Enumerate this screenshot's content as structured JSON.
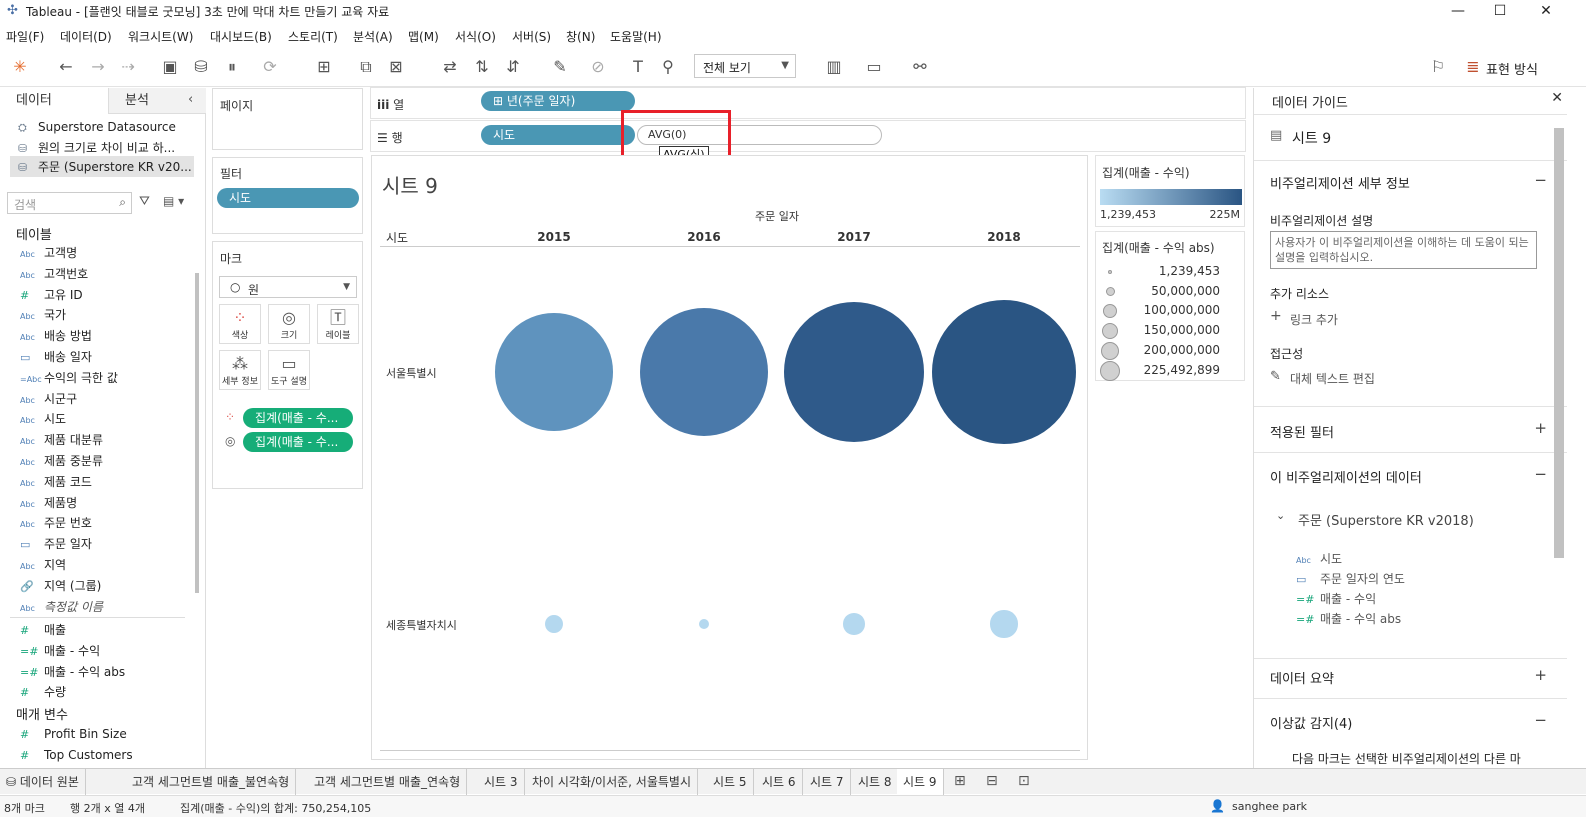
{
  "window": {
    "title": "Tableau - [플랜잇 태블로 굿모닝] 3초 만에 막대 차트 만들기 교육 자료",
    "minimize": "—",
    "maximize": "☐",
    "close": "✕"
  },
  "menu": [
    "파일(F)",
    "데이터(D)",
    "워크시트(W)",
    "대시보드(B)",
    "스토리(T)",
    "분석(A)",
    "맵(M)",
    "서식(O)",
    "서버(S)",
    "창(N)",
    "도움말(H)"
  ],
  "toolbar": {
    "view_select": "전체 보기",
    "show_me_label": "표현 방식"
  },
  "left_pane": {
    "tab_data": "데이터",
    "tab_analytics": "분석",
    "datasources": [
      "Superstore Datasource",
      "원의 크기로 차이 비교 하...",
      "주문 (Superstore KR v20..."
    ],
    "search_placeholder": "검색",
    "tables_header": "테이블",
    "dimensions": [
      {
        "type": "Abc",
        "name": "고객명"
      },
      {
        "type": "Abc",
        "name": "고객번호"
      },
      {
        "type": "#",
        "name": "고유 ID"
      },
      {
        "type": "Abc",
        "name": "국가"
      },
      {
        "type": "Abc",
        "name": "배송 방법"
      },
      {
        "type": "date",
        "name": "배송 일자"
      },
      {
        "type": "=Abc",
        "name": "수익의 극한 값"
      },
      {
        "type": "Abc",
        "name": "시군구"
      },
      {
        "type": "Abc",
        "name": "시도"
      },
      {
        "type": "Abc",
        "name": "제품 대분류"
      },
      {
        "type": "Abc",
        "name": "제품 중분류"
      },
      {
        "type": "Abc",
        "name": "제품 코드"
      },
      {
        "type": "Abc",
        "name": "제품명"
      },
      {
        "type": "Abc",
        "name": "주문 번호"
      },
      {
        "type": "date",
        "name": "주문 일자"
      },
      {
        "type": "Abc",
        "name": "지역"
      },
      {
        "type": "clip",
        "name": "지역 (그룹)"
      },
      {
        "type": "Abc",
        "name": "측정값 이름"
      }
    ],
    "measures": [
      {
        "type": "#",
        "name": "매출"
      },
      {
        "type": "=#",
        "name": "매출 - 수익"
      },
      {
        "type": "=#",
        "name": "매출 - 수익 abs"
      },
      {
        "type": "#",
        "name": "수량"
      }
    ],
    "params_header": "매개 변수",
    "params": [
      {
        "type": "#",
        "name": "Profit Bin Size"
      },
      {
        "type": "#",
        "name": "Top Customers"
      }
    ]
  },
  "cards": {
    "pages": "페이지",
    "filters": "필터",
    "filter_pill": "시도",
    "marks": "마크",
    "mark_type": "원",
    "mark_buttons": [
      "색상",
      "크기",
      "레이블",
      "세부 정보",
      "도구 설명"
    ],
    "mark_pills": [
      "집계(매출 - 수...",
      "집계(매출 - 수..."
    ]
  },
  "shelves": {
    "columns_label": "열",
    "rows_label": "행",
    "columns_pill": "년(주문 일자)",
    "rows_pill": "시도",
    "rows_edit_text": "AVG(0)",
    "tooltip": "AVG(식)"
  },
  "view": {
    "sheet_title": "시트 9",
    "column_header": "주문 일자",
    "row_header": "시도",
    "years": [
      "2015",
      "2016",
      "2017",
      "2018"
    ],
    "rows": [
      "서울특별시",
      "세종특별자치시"
    ]
  },
  "chart_data": {
    "type": "scatter",
    "x": [
      "2015",
      "2016",
      "2017",
      "2018"
    ],
    "series": [
      {
        "name": "서울특별시",
        "values": [
          150000000,
          180000000,
          215000000,
          225492899
        ],
        "colors": [
          "#5f93be",
          "#4a79aa",
          "#2f5a8a",
          "#2a5583"
        ]
      },
      {
        "name": "세종특별자치시",
        "values": [
          3500000,
          1239453,
          5000000,
          8000000
        ],
        "colors": [
          "#b4d8ef",
          "#b4d8ef",
          "#b4d8ef",
          "#b4d8ef"
        ]
      }
    ]
  },
  "legend_color": {
    "title": "집계(매출 - 수익)",
    "min": "1,239,453",
    "max": "225M",
    "min_color": "#b9dcf2",
    "max_color": "#2a5583"
  },
  "legend_size": {
    "title": "집계(매출 - 수익 abs)",
    "items": [
      "1,239,453",
      "50,000,000",
      "100,000,000",
      "150,000,000",
      "200,000,000",
      "225,492,899"
    ]
  },
  "guide": {
    "header": "데이터 가이드",
    "sheet": "시트 9",
    "details_title": "비주얼리제이션 세부 정보",
    "desc_label": "비주얼리제이션 설명",
    "desc_placeholder": "사용자가 이 비주얼리제이션을 이해하는 데 도움이 되는 설명을 입력하십시오.",
    "resources_label": "추가 리소스",
    "add_link": "링크 추가",
    "access_label": "접근성",
    "alt_text": "대체 텍스트 편집",
    "filters_title": "적용된 필터",
    "data_title": "이 비주얼리제이션의 데이터",
    "datasource": "주문 (Superstore KR v2018)",
    "fields": [
      {
        "type": "Abc",
        "name": "시도"
      },
      {
        "type": "date",
        "name": "주문 일자의 연도"
      },
      {
        "type": "=#",
        "name": "매출 - 수익"
      },
      {
        "type": "=#",
        "name": "매출 - 수익 abs"
      }
    ],
    "summary_title": "데이터 요약",
    "outlier_title": "이상값 감지(4)",
    "outlier_text": "다음 마크는 선택한 비주얼리제이션의 다른 마"
  },
  "bottom_tabs": [
    "데이터 원본",
    "고객 세그먼트별 매출_불연속형",
    "고객 세그먼트별 매출_연속형",
    "시트 3",
    "차이 시각화/이서준, 서울특별시",
    "시트 5",
    "시트 6",
    "시트 7",
    "시트 8",
    "시트 9"
  ],
  "status": {
    "left": "8개 마크",
    "middle": "행 2개 x 열 4개",
    "sum": "집계(매출 - 수익)의 합계: 750,254,105",
    "user": "sanghee park"
  }
}
